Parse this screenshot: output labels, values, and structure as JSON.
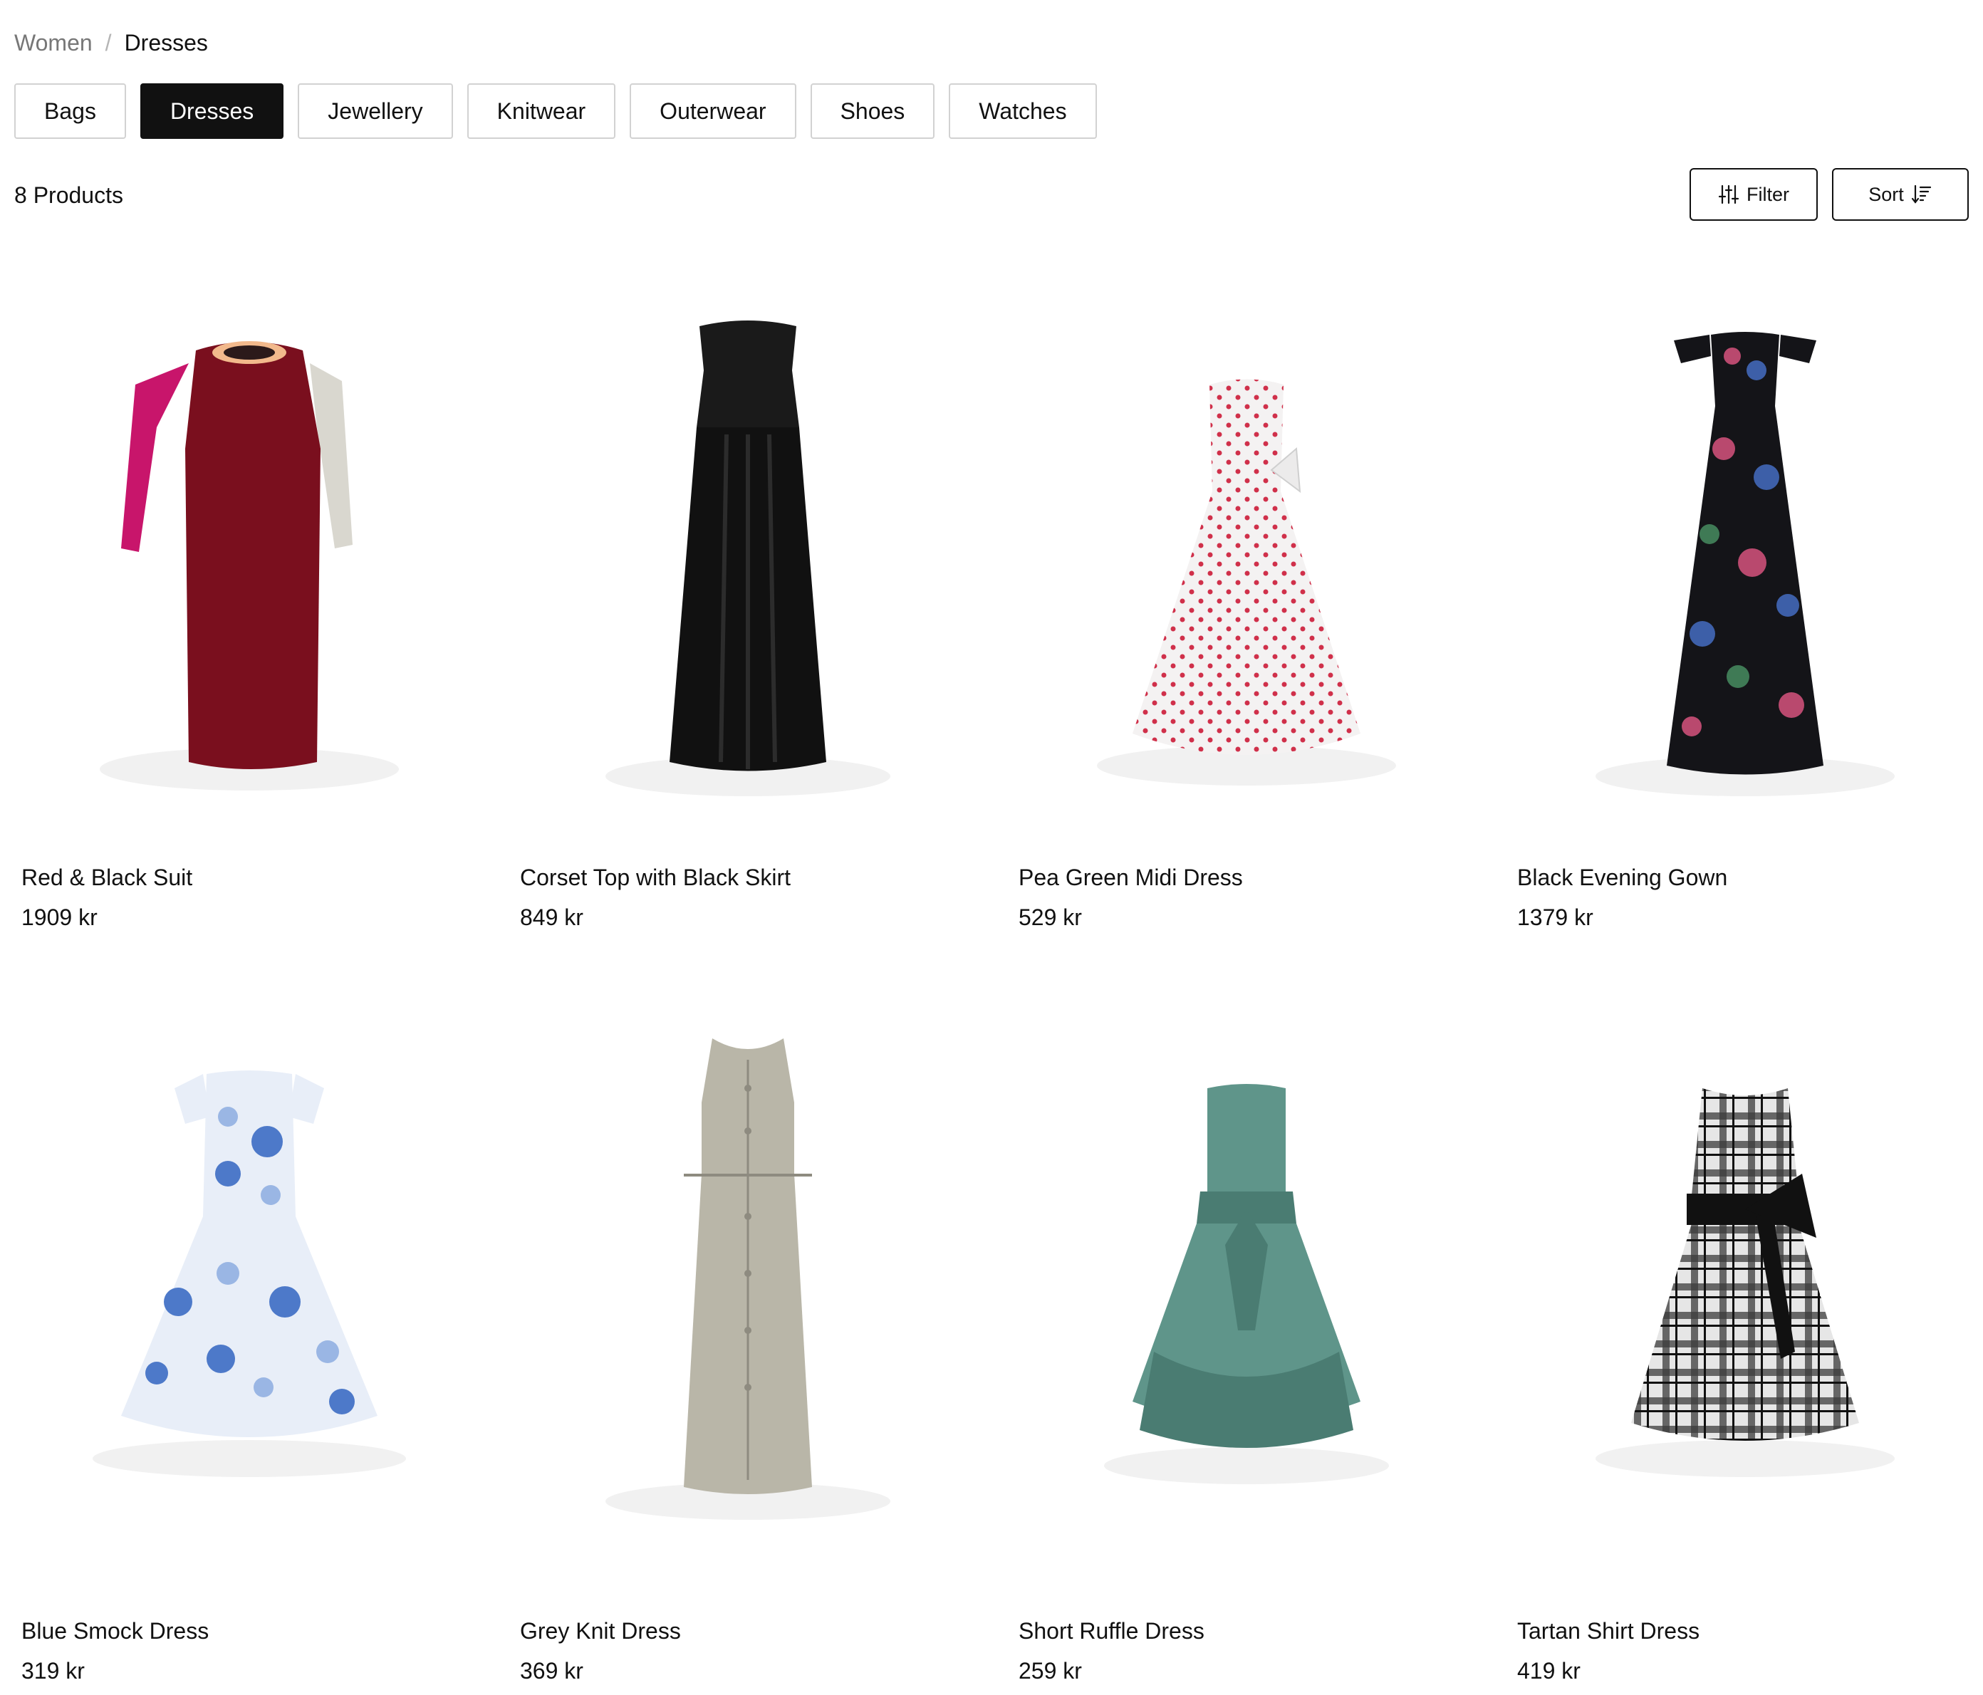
{
  "breadcrumb": {
    "parent": "Women",
    "separator": "/",
    "current": "Dresses"
  },
  "tabs": [
    {
      "label": "Bags",
      "active": false
    },
    {
      "label": "Dresses",
      "active": true
    },
    {
      "label": "Jewellery",
      "active": false
    },
    {
      "label": "Knitwear",
      "active": false
    },
    {
      "label": "Outerwear",
      "active": false
    },
    {
      "label": "Shoes",
      "active": false
    },
    {
      "label": "Watches",
      "active": false
    }
  ],
  "results": {
    "count_label": "8 Products"
  },
  "toolbar": {
    "filter_label": "Filter",
    "filter_icon": "sliders-icon",
    "sort_label": "Sort",
    "sort_icon": "sort-descending-icon"
  },
  "products": [
    {
      "name": "Red & Black Suit",
      "price": "1909 kr",
      "image": "dress-red-colorblock-longsleeve",
      "colors": [
        "#7a0f1e",
        "#c8156b",
        "#d9d7cf",
        "#f2b98c"
      ]
    },
    {
      "name": "Corset Top with Black Skirt",
      "price": "849 kr",
      "image": "dress-black-corset-gown",
      "colors": [
        "#111111",
        "#2a2a2a"
      ]
    },
    {
      "name": "Pea Green Midi Dress",
      "price": "529 kr",
      "image": "dress-white-red-polka-dot",
      "colors": [
        "#f4f2f2",
        "#d0304a"
      ]
    },
    {
      "name": "Black Evening Gown",
      "price": "1379 kr",
      "image": "dress-black-floral-gown",
      "colors": [
        "#141418",
        "#b9496e",
        "#3d5fa8",
        "#3f7a55"
      ]
    },
    {
      "name": "Blue Smock Dress",
      "price": "319 kr",
      "image": "dress-blue-bubble-print",
      "colors": [
        "#e8eef8",
        "#4d79c9",
        "#9ab6e4"
      ]
    },
    {
      "name": "Grey Knit Dress",
      "price": "369 kr",
      "image": "dress-grey-button-front",
      "colors": [
        "#b9b6a8",
        "#8e8b80"
      ]
    },
    {
      "name": "Short Ruffle Dress",
      "price": "259 kr",
      "image": "dress-teal-ruffle-strapless",
      "colors": [
        "#5f958a",
        "#4a7c72"
      ]
    },
    {
      "name": "Tartan Shirt Dress",
      "price": "419 kr",
      "image": "dress-black-white-tartan",
      "colors": [
        "#e6e6e6",
        "#3a3a3a",
        "#111111"
      ]
    }
  ]
}
